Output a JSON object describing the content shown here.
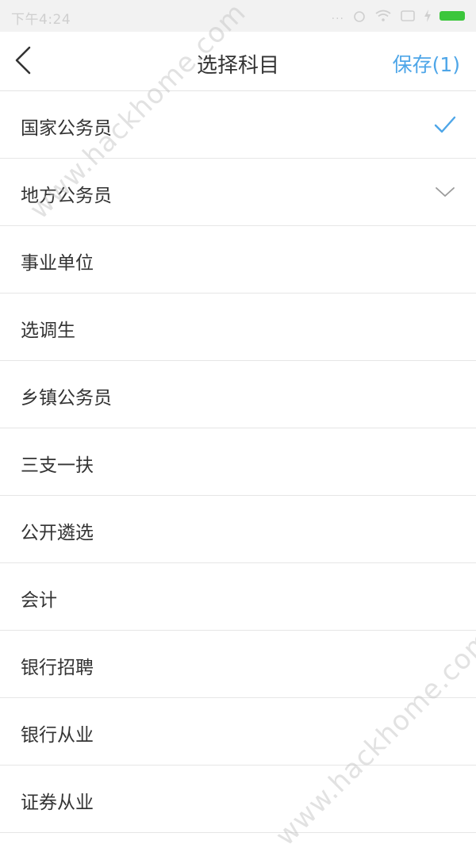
{
  "status_bar": {
    "time": "下午4:24",
    "dots": "...",
    "battery_color": "#3cc63c"
  },
  "header": {
    "title": "选择科目",
    "save_label": "保存(1)",
    "accent_color": "#4ea6e8"
  },
  "items": [
    {
      "label": "国家公务员",
      "icon": "check-icon"
    },
    {
      "label": "地方公务员",
      "icon": "chevron-down-icon"
    },
    {
      "label": "事业单位"
    },
    {
      "label": "选调生"
    },
    {
      "label": "乡镇公务员"
    },
    {
      "label": "三支一扶"
    },
    {
      "label": "公开遴选"
    },
    {
      "label": "会计"
    },
    {
      "label": "银行招聘"
    },
    {
      "label": "银行从业"
    },
    {
      "label": "证券从业"
    }
  ],
  "watermark": "www.hackhome.com"
}
